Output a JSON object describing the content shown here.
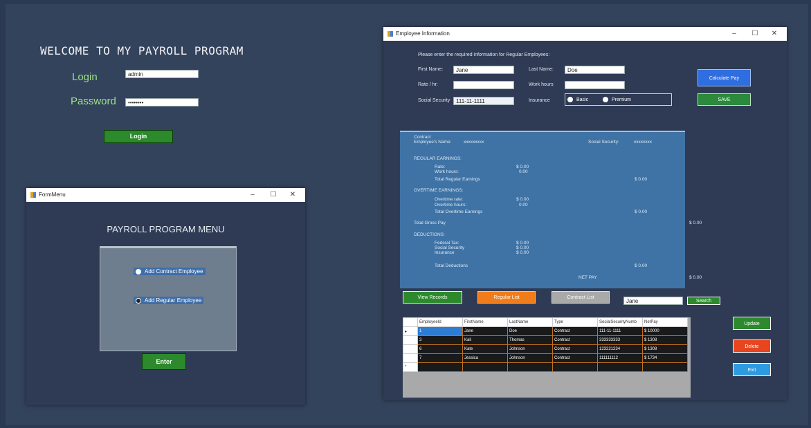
{
  "login_screen": {
    "welcome": "WELCOME TO MY PAYROLL PROGRAM",
    "login_label": "Login",
    "login_value": "admin",
    "password_label": "Password",
    "password_value": "••••••••",
    "login_button": "Login"
  },
  "form_menu": {
    "window_title": "FormMenu",
    "heading": "PAYROLL PROGRAM MENU",
    "options": [
      "Add Contract Employee",
      "Add Regular Employee"
    ],
    "enter_button": "Enter"
  },
  "employee_info": {
    "window_title": "Employee Information",
    "instruction": "Please enter the required information for Regular Employees:",
    "first_name_label": "First Name:",
    "first_name_value": "Jane",
    "last_name_label": "Last Name:",
    "last_name_value": "Doe",
    "rate_label": "Rate / hr:",
    "rate_value": "",
    "work_hours_label": "Work hours",
    "work_hours_value": "",
    "ssn_label": "Social Security",
    "ssn_value": "111-11-1111",
    "insurance_label": "Insurance",
    "insurance_options": [
      "Basic",
      "Premium"
    ],
    "calculate_button": "Calculate Pay",
    "save_button": "SAVE",
    "summary": {
      "type": "Contract",
      "employee_name_label": "Employee's Name:",
      "employee_name_value": "xxxxxxxxx",
      "ss_label": "Social Security:",
      "ss_value": "xxxxxxxx",
      "regular_earnings": "REGULAR EARNINGS:",
      "rate": "Rate:",
      "rate_val": "$ 0.00",
      "work_hours": "Work hours:",
      "work_hours_val": "0.00",
      "total_regular": "Total Regular Earnings",
      "total_regular_val": "$ 0.00",
      "overtime_earnings": "OVERTIME EARNINGS:",
      "ot_rate": "Overtime rate:",
      "ot_rate_val": "$ 0.00",
      "ot_hours": "Overtime hours:",
      "ot_hours_val": "0.00",
      "total_ot": "Total Overtime Earnings",
      "total_ot_val": "$ 0.00",
      "gross": "Total Gross Pay",
      "gross_val": "$ 0.00",
      "deductions": "DEDUCTIONS:",
      "federal": "Federal Tax:",
      "federal_val": "$ 0.00",
      "social": "Social Security",
      "social_val": "$ 0.00",
      "insurance": "Insurance",
      "insurance_val": "$ 0.00",
      "total_ded": "Total Deductions",
      "total_ded_val": "$ 0.00",
      "net": "NET PAY",
      "net_val": "$ 0.00"
    },
    "view_records": "View Records",
    "regular_list": "Regular List",
    "contract_list": "Contract List",
    "search_value": "Jane",
    "search_button": "Search",
    "update_button": "Update",
    "delete_button": "Delete",
    "exit_button": "Exit",
    "grid": {
      "columns": [
        "EmployeeId",
        "FirstName",
        "LastName",
        "Type",
        "SocialSecurityNumb",
        "NetPay"
      ],
      "rows": [
        [
          "1",
          "Jane",
          "Doe",
          "Contract",
          "111-11-1111",
          "$ 10000"
        ],
        [
          "3",
          "Kali",
          "Thomas",
          "Contract",
          "333333333",
          "$ 1308"
        ],
        [
          "6",
          "Kate",
          "Johnson",
          "Contract",
          "123221234",
          "$ 1308"
        ],
        [
          "7",
          "Jessica",
          "Johnson",
          "Contract",
          "111111112",
          "$ 1734"
        ]
      ]
    }
  },
  "colors": {
    "green": "#2c8a2c",
    "orange": "#f07d1a",
    "red": "#e8451e",
    "blue": "#2e9ae0",
    "panel": "#3f73a6"
  }
}
